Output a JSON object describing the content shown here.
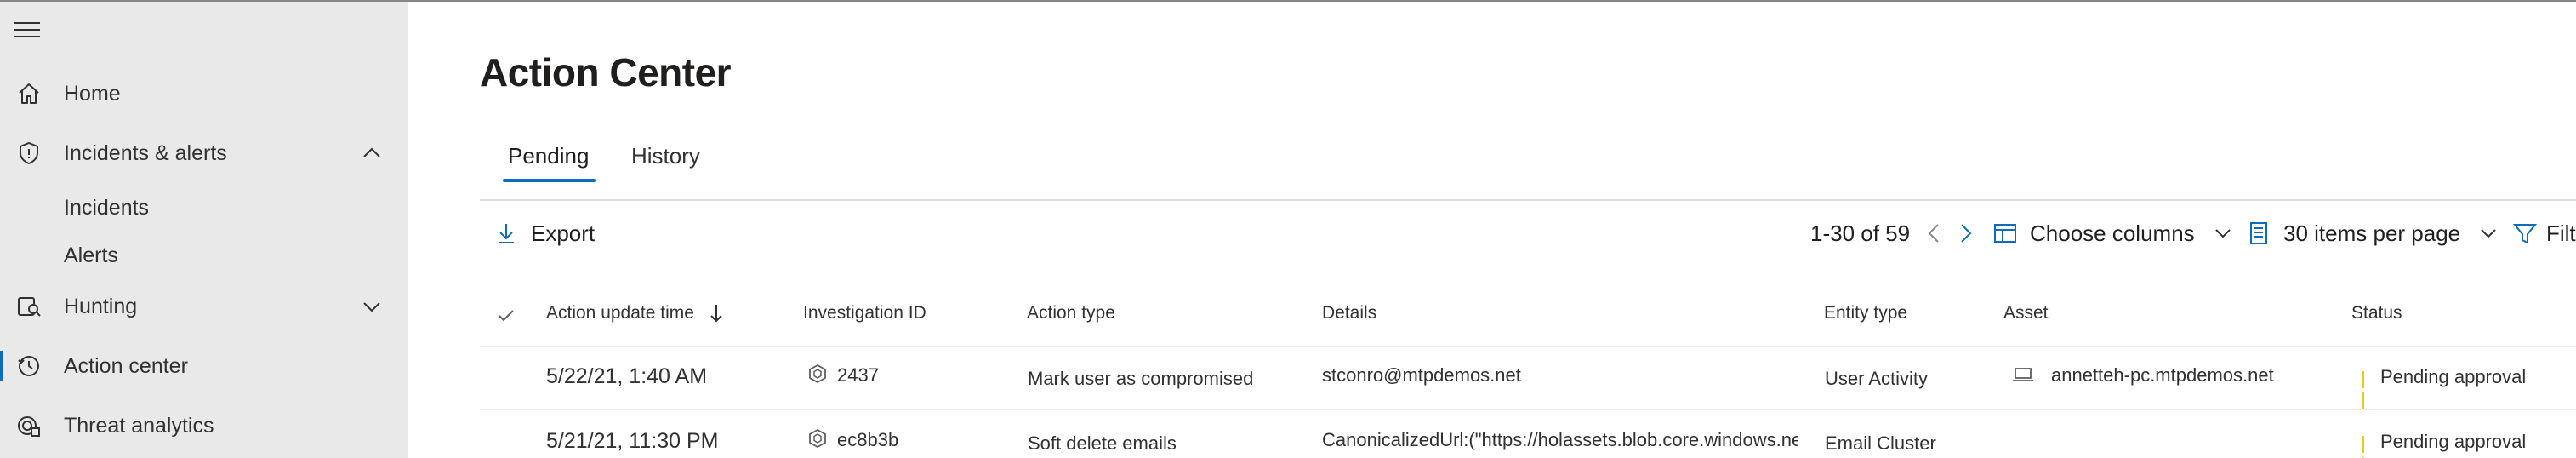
{
  "sidebar": {
    "items": [
      {
        "label": "Home",
        "icon": "home-icon"
      },
      {
        "label": "Incidents & alerts",
        "icon": "shield-icon",
        "expanded": true
      },
      {
        "label": "Incidents"
      },
      {
        "label": "Alerts"
      },
      {
        "label": "Hunting",
        "icon": "hunting-icon",
        "expanded": false
      },
      {
        "label": "Action center",
        "icon": "action-center-icon",
        "active": true
      },
      {
        "label": "Threat analytics",
        "icon": "threat-analytics-icon"
      }
    ]
  },
  "page": {
    "title": "Action Center"
  },
  "tabs": [
    {
      "label": "Pending",
      "active": true
    },
    {
      "label": "History",
      "active": false
    }
  ],
  "toolbar": {
    "export_label": "Export",
    "pagination": "1-30 of 59",
    "choose_columns_label": "Choose columns",
    "items_per_page_label": "30 items per page",
    "filter_label": "Filt"
  },
  "table": {
    "columns": [
      "Action update time",
      "Investigation ID",
      "Action type",
      "Details",
      "Entity type",
      "Asset",
      "Status"
    ],
    "rows": [
      {
        "time": "5/22/21, 1:40 AM",
        "investigation_id": "2437",
        "action_type": "Mark user as compromised",
        "details": "stconro@mtpdemos.net",
        "entity_type": "User Activity",
        "asset": "annetteh-pc.mtpdemos.net",
        "status": "Pending approval"
      },
      {
        "time": "5/21/21, 11:30 PM",
        "investigation_id": "ec8b3b",
        "action_type": "Soft delete emails",
        "details": "CanonicalizedUrl:(\"https://holassets.blob.core.windows.net/pa",
        "entity_type": "Email Cluster",
        "asset": "",
        "status": "Pending approval"
      }
    ]
  },
  "colors": {
    "accent": "#0f6cbd",
    "status_pending": "#f2c811",
    "sidebar_bg": "#e9e9e9"
  }
}
